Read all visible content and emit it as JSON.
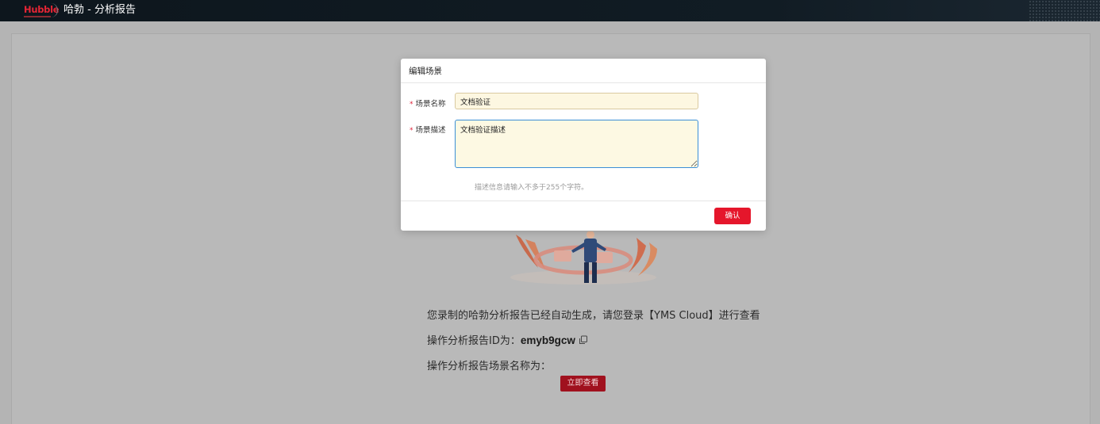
{
  "header": {
    "logo_text": "Hubble",
    "title": "哈勃 - 分析报告"
  },
  "report": {
    "message": "您录制的哈勃分析报告已经自动生成，请您登录【YMS Cloud】进行查看",
    "id_label": "操作分析报告ID为：",
    "id_value": "emyb9gcw",
    "scene_label": "操作分析报告场景名称为：",
    "scene_value": "",
    "view_button": "立即查看",
    "copy_icon": "copy-icon"
  },
  "modal": {
    "title": "编辑场景",
    "required_mark": "*",
    "name_label": "场景名称",
    "name_value": "文档验证",
    "desc_label": "场景描述",
    "desc_value": "文档验证描述",
    "hint": "描述信息请输入不多于255个字符。",
    "confirm_button": "确认"
  },
  "colors": {
    "topbar": "#0f1820",
    "brand_red": "#e5162b",
    "overlay": "#b4b4b4",
    "focus_border": "#3b8fd6"
  }
}
